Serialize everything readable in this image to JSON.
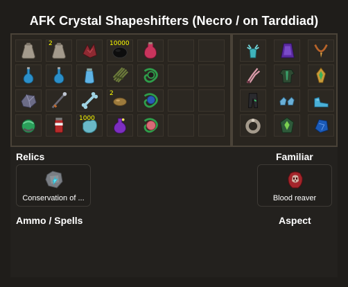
{
  "title": "AFK Crystal Shapeshifters (Necro / on Tarddiad)",
  "inventory": {
    "rows": [
      [
        {
          "icon": "bag-icon",
          "qty": ""
        },
        {
          "icon": "bag-icon",
          "qty": "2"
        },
        {
          "icon": "red-shards-icon",
          "qty": ""
        },
        {
          "icon": "coins-pile-icon",
          "qty": "10000"
        },
        {
          "icon": "pink-potion-icon",
          "qty": ""
        },
        {
          "icon": "empty",
          "qty": ""
        },
        {
          "icon": "empty",
          "qty": ""
        }
      ],
      [
        {
          "icon": "blue-flask-icon",
          "qty": ""
        },
        {
          "icon": "blue-flask-icon",
          "qty": ""
        },
        {
          "icon": "blue-vial-icon",
          "qty": ""
        },
        {
          "icon": "bundle-icon",
          "qty": ""
        },
        {
          "icon": "green-vine-icon",
          "qty": ""
        },
        {
          "icon": "empty",
          "qty": ""
        },
        {
          "icon": "empty",
          "qty": ""
        }
      ],
      [
        {
          "icon": "crystal-icon",
          "qty": ""
        },
        {
          "icon": "staff-icon",
          "qty": ""
        },
        {
          "icon": "bone-icon",
          "qty": ""
        },
        {
          "icon": "seed-icon",
          "qty": "2"
        },
        {
          "icon": "blue-vine-icon",
          "qty": ""
        },
        {
          "icon": "empty",
          "qty": ""
        },
        {
          "icon": "empty",
          "qty": ""
        }
      ],
      [
        {
          "icon": "orb-icon",
          "qty": ""
        },
        {
          "icon": "red-vial-icon",
          "qty": ""
        },
        {
          "icon": "teal-scroll-icon",
          "qty": "1000"
        },
        {
          "icon": "purple-potion-icon",
          "qty": ""
        },
        {
          "icon": "pink-vine-icon",
          "qty": ""
        },
        {
          "icon": "empty",
          "qty": ""
        },
        {
          "icon": "empty",
          "qty": ""
        }
      ]
    ]
  },
  "equipment": {
    "rows": [
      [
        {
          "icon": "antler-helm-icon"
        },
        {
          "icon": "purple-cape-icon"
        },
        {
          "icon": "orange-necklace-icon"
        }
      ],
      [
        {
          "icon": "claw-weapon-icon"
        },
        {
          "icon": "green-body-icon"
        },
        {
          "icon": "golden-offhand-icon"
        }
      ],
      [
        {
          "icon": "dark-legs-icon"
        },
        {
          "icon": "blue-gloves-icon"
        },
        {
          "icon": "blue-boots-icon"
        }
      ],
      [
        {
          "icon": "ring-icon"
        },
        {
          "icon": "green-pocket-icon"
        },
        {
          "icon": "blue-ammo-icon"
        }
      ]
    ]
  },
  "sections": {
    "relics": "Relics",
    "familiar": "Familiar",
    "ammo": "Ammo / Spells",
    "aspect": "Aspect"
  },
  "relic": {
    "label": "Conservation of ...",
    "icon": "conservation-relic-icon"
  },
  "familiar": {
    "label": "Blood reaver",
    "icon": "blood-reaver-icon"
  }
}
